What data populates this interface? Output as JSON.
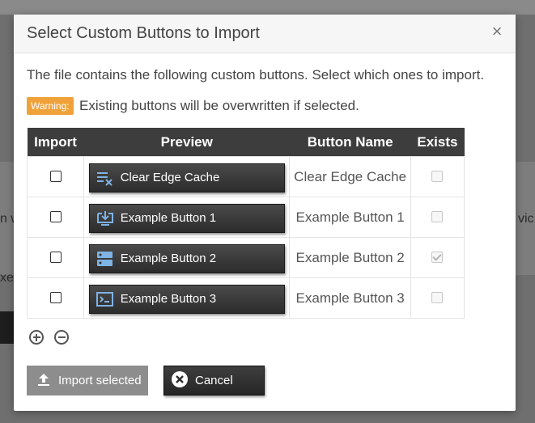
{
  "background": {
    "fragment_left_1": "n w",
    "fragment_right_1": "vic",
    "fragment_left_2": "xe"
  },
  "dialog": {
    "title": "Select Custom Buttons to Import",
    "close_icon": "close-icon",
    "intro": "The file contains the following custom buttons. Select which ones to import.",
    "warning_badge": "Warning:",
    "warning_text": "Existing buttons will be overwritten if selected.",
    "table": {
      "headers": {
        "import": "Import",
        "preview": "Preview",
        "name": "Button Name",
        "exists": "Exists"
      },
      "rows": [
        {
          "import_checked": false,
          "preview_label": "Clear Edge Cache",
          "icon": "clear-list-icon",
          "name": "Clear Edge Cache",
          "exists": false
        },
        {
          "import_checked": false,
          "preview_label": "Example Button 1",
          "icon": "monitor-download-icon",
          "name": "Example Button 1",
          "exists": false
        },
        {
          "import_checked": false,
          "preview_label": "Example Button 2",
          "icon": "server-icon",
          "name": "Example Button 2",
          "exists": true
        },
        {
          "import_checked": false,
          "preview_label": "Example Button 3",
          "icon": "terminal-icon",
          "name": "Example Button 3",
          "exists": false
        }
      ]
    },
    "add_icon": "plus-circle-icon",
    "remove_icon": "minus-circle-icon",
    "import_label": "Import selected",
    "cancel_label": "Cancel",
    "colors": {
      "warning": "#f0a23a",
      "header_bg": "#3d3d3d",
      "import_btn": "#8d8d8d"
    }
  }
}
